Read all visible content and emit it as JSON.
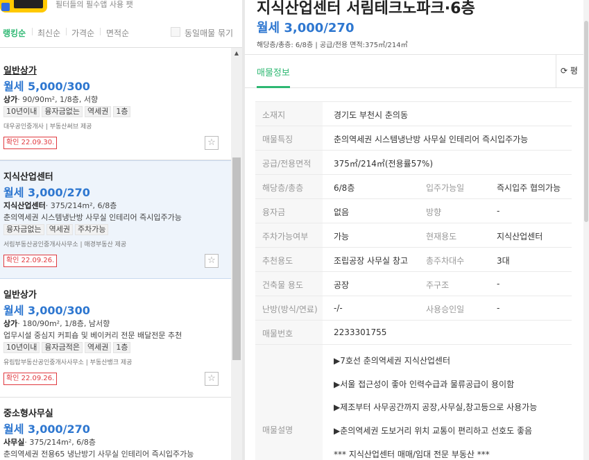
{
  "banner": {
    "text": "필터들의 필수앱 사용 팻"
  },
  "sort": {
    "items": [
      "랭킹순",
      "최신순",
      "가격순",
      "면적순"
    ],
    "same_label": "동일매물 묶기"
  },
  "listings": [
    {
      "type": "일반상가",
      "price": "월세 5,000/300",
      "spec_type": "상가",
      "spec": "· 90/90m², 1/8층, 서향",
      "desc": "",
      "tags": [
        "10년이내",
        "융자금없는",
        "역세권",
        "1층"
      ],
      "agent": "대우공인중개사 | 부동산써브 제공",
      "confirm": "확인 22.09.30."
    },
    {
      "type": "지식산업센터",
      "price": "월세 3,000/270",
      "spec_type": "지식산업센터",
      "spec": "· 375/214m², 6/8층",
      "desc": "춘의역세권 시스템냉난방 사무실 인테리어 즉시입주가능",
      "tags": [
        "융자금없는",
        "역세권",
        "주차가능"
      ],
      "agent": "서림부동산공인중개사사무소 | 매경부동산 제공",
      "confirm": "확인 22.09.26."
    },
    {
      "type": "일반상가",
      "price": "월세 3,000/300",
      "spec_type": "상가",
      "spec": "· 180/90m², 1/8층, 남서향",
      "desc": "업무시설 중심지 커피숍 및 베이커리 전문 배달전문 추천",
      "tags": [
        "10년이내",
        "융자금적은",
        "역세권",
        "1층"
      ],
      "agent": "유림탑부동산공인중개사사무소 | 부동산뱅크 제공",
      "confirm": "확인 22.09.26."
    },
    {
      "type": "중소형사무실",
      "price": "월세 3,000/270",
      "spec_type": "사무실",
      "spec": "· 375/214m², 6/8층",
      "desc": "춘의역세권 전용65 냉난방기 사무실 인테리어 즉시입주가능",
      "tags": [],
      "agent": "",
      "confirm": ""
    }
  ],
  "detail": {
    "title": "지식산업센터 서림테크노파크·6층",
    "price": "월세 3,000/270",
    "meta": "해당층/총층: 6/8층 | 공급/전용 면적:375㎡/214㎡",
    "tab": "매물정보",
    "refresh": "⟳ 평",
    "rows": [
      {
        "l": "소재지",
        "v": "경기도 부천시 춘의동"
      },
      {
        "l": "매물특징",
        "v": "춘의역세권 시스템냉난방 사무실 인테리어 즉시입주가능"
      },
      {
        "l": "공급/전용면적",
        "v": "375㎡/214㎡(전용률57%)"
      },
      {
        "l": "해당층/총층",
        "v": "6/8층",
        "l2": "입주가능일",
        "v2": "즉시입주 협의가능"
      },
      {
        "l": "융자금",
        "v": "없음",
        "l2": "방향",
        "v2": "-"
      },
      {
        "l": "주차가능여부",
        "v": "가능",
        "l2": "현재용도",
        "v2": "지식산업센터"
      },
      {
        "l": "추천용도",
        "v": "조립공장 사무실 창고",
        "l2": "총주차대수",
        "v2": "3대"
      },
      {
        "l": "건축물 용도",
        "v": "공장",
        "l2": "주구조",
        "v2": "-"
      },
      {
        "l": "난방(방식/연료)",
        "v": "-/-",
        "l2": "사용승인일",
        "v2": "-"
      },
      {
        "l": "매물번호",
        "v": "2233301755"
      }
    ],
    "desc_label": "매물설명",
    "desc_lines": [
      "▶7호선 춘의역세권 지식산업센터",
      "▶서울 접근성이 좋아 인력수급과 물류공급이 용이함",
      "▶제조부터 사무공간까지 공장,사무실,창고등으로 사용가능",
      "▶춘의역세권 도보거리 위치 교통이 편리하고 선호도 좋음",
      "*** 지식산업센터 매매/임대 전문 부동산 ***"
    ]
  }
}
